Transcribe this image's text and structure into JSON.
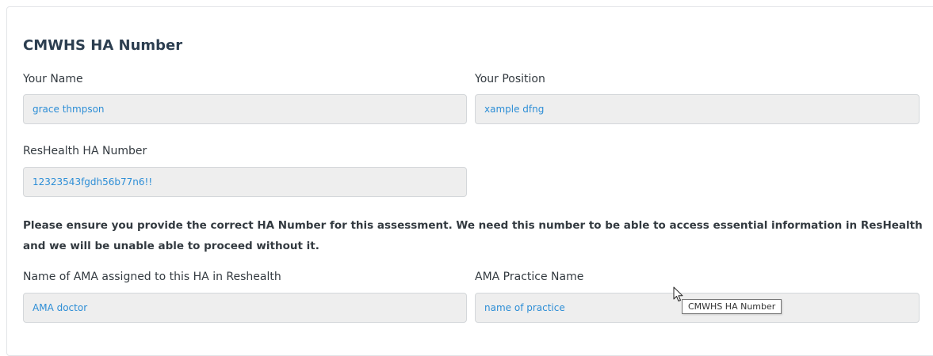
{
  "section": {
    "title": "CMWHS HA Number"
  },
  "fields": {
    "your_name": {
      "label": "Your Name",
      "value": "grace thmpson"
    },
    "your_position": {
      "label": "Your Position",
      "value": "xample dfng"
    },
    "reshealth_ha_number": {
      "label": "ResHealth HA Number",
      "value": "12323543fgdh56b77n6!!"
    },
    "ama_name": {
      "label": "Name of AMA assigned to this HA in Reshealth",
      "value": "AMA doctor"
    },
    "ama_practice_name": {
      "label": "AMA Practice Name",
      "value": "name of practice"
    }
  },
  "notice": "Please ensure you provide the correct HA Number for this assessment. We need this number to be able to access essential information in ResHealth and we will be unable able to proceed without it.",
  "tooltip": {
    "text": "CMWHS HA Number"
  },
  "cursor": {
    "icon": "mouse-pointer-icon"
  }
}
